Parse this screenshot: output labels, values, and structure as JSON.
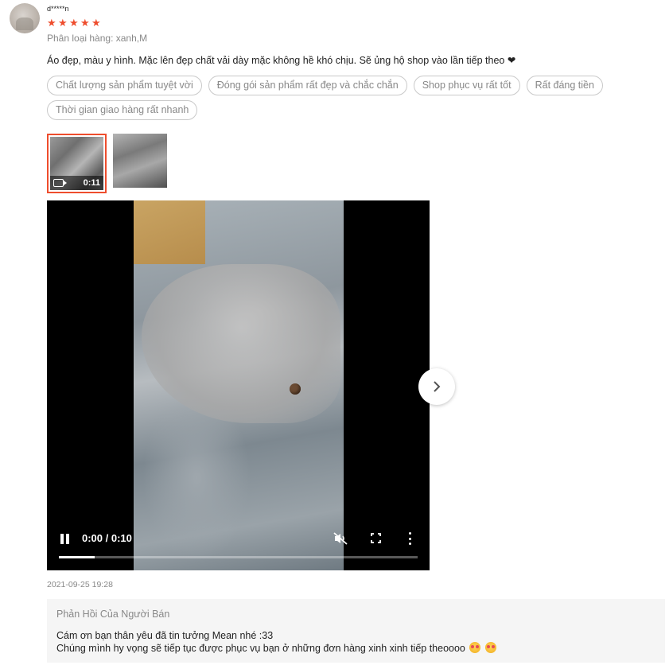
{
  "review": {
    "username": "d*****n",
    "rating": 5,
    "variation": "Phân loại hàng: xanh,M",
    "text": "Áo đẹp, màu y hình. Mặc lên đẹp chất vải dày mặc không hề khó chịu. Sẽ ủng hộ shop vào lần tiếp theo ❤",
    "tags": [
      "Chất lượng sản phẩm tuyệt vời",
      "Đóng gói sản phẩm rất đẹp và chắc chắn",
      "Shop phục vụ rất tốt",
      "Rất đáng tiền",
      "Thời gian giao hàng rất nhanh"
    ],
    "thumbnails": [
      {
        "type": "video",
        "duration": "0:11",
        "selected": true
      },
      {
        "type": "image",
        "selected": false
      }
    ],
    "date": "2021-09-25 19:28"
  },
  "player": {
    "time": "0:00 / 0:10",
    "progress": 0.1,
    "icons": [
      "pause-icon",
      "mute-icon",
      "fullscreen-icon",
      "more-vertical-icon",
      "chevron-right-icon"
    ]
  },
  "seller_reply": {
    "title": "Phản Hồi Của Người Bán",
    "line1": "Cám ơn bạn thân yêu đã tin tưởng Mean nhé :33",
    "line2": "Chúng mình hy vọng sẽ tiếp tục được phục vụ bạn ở những đơn hàng xinh xinh tiếp theoooo"
  },
  "colors": {
    "accent": "#ee4d2d",
    "muted_text": "#888888",
    "reply_bg": "#f5f5f5"
  }
}
